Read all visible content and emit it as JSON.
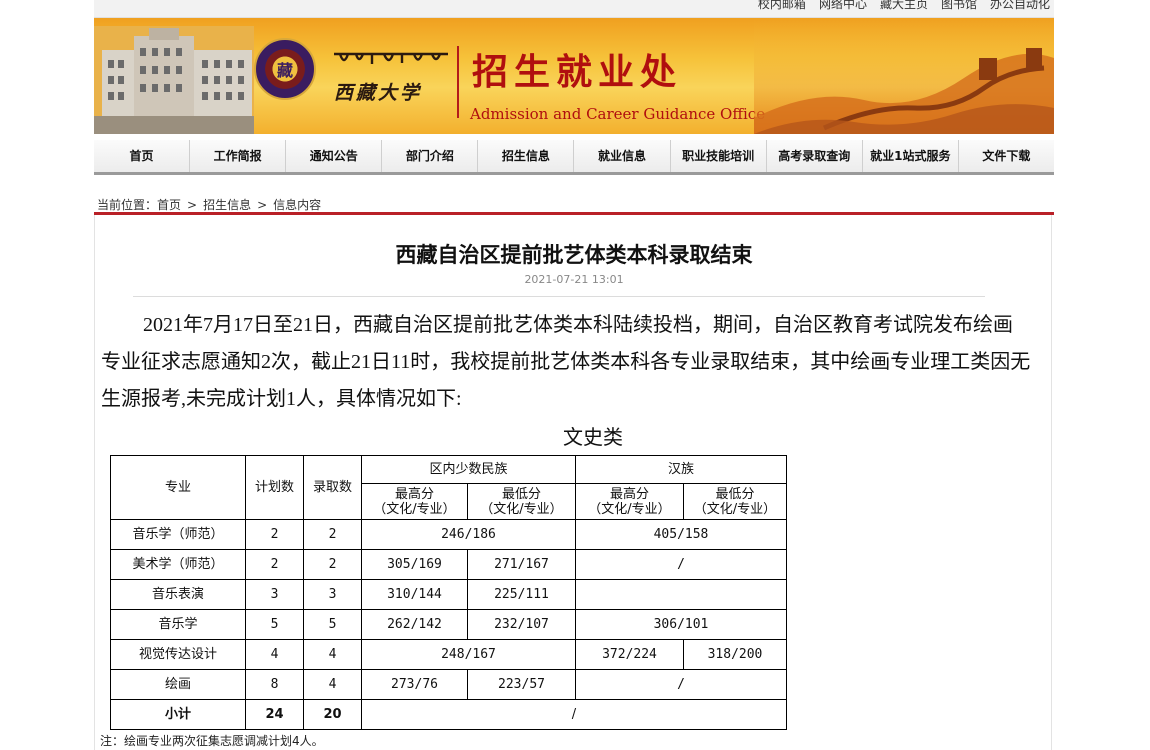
{
  "toplinks": [
    "校内邮箱",
    "网络中心",
    "藏大主页",
    "图书馆",
    "办公自动化"
  ],
  "banner": {
    "seal_char": "藏",
    "university_name": "西藏大学",
    "office_cn": "招生就业处",
    "office_en": "Admission and Career Guidance Office"
  },
  "nav": [
    "首页",
    "工作简报",
    "通知公告",
    "部门介绍",
    "招生信息",
    "就业信息",
    "职业技能培训",
    "高考录取查询",
    "就业1站式服务",
    "文件下载"
  ],
  "breadcrumb": {
    "prefix": "当前位置：",
    "items": [
      "首页",
      "招生信息",
      "信息内容"
    ],
    "separator": ">"
  },
  "article": {
    "title": "西藏自治区提前批艺体类本科录取结束",
    "date": "2021-07-21 13:01",
    "paragraph": "2021年7月17日至21日，西藏自治区提前批艺体类本科陆续投档，期间，自治区教育考试院发布绘画专业征求志愿通知2次，截止21日11时，我校提前批艺体类本科各专业录取结束，其中绘画专业理工类因无生源报考,未完成计划1人，具体情况如下:",
    "table_title": "文史类",
    "table": {
      "h_major": "专业",
      "h_plan": "计划数",
      "h_admit": "录取数",
      "h_minority": "区内少数民族",
      "h_han": "汉族",
      "h_max": "最高分",
      "h_min": "最低分",
      "h_sub": "（文化/专业）",
      "rows": [
        {
          "major": "音乐学（师范）",
          "plan": "2",
          "admit": "2",
          "m_merged": "246/186",
          "h_merged": "405/158"
        },
        {
          "major": "美术学（师范）",
          "plan": "2",
          "admit": "2",
          "m_max": "305/169",
          "m_min": "271/167",
          "h_merged": "/"
        },
        {
          "major": "音乐表演",
          "plan": "3",
          "admit": "3",
          "m_max": "310/144",
          "m_min": "225/111",
          "h_merged": ""
        },
        {
          "major": "音乐学",
          "plan": "5",
          "admit": "5",
          "m_max": "262/142",
          "m_min": "232/107",
          "h_merged": "306/101"
        },
        {
          "major": "视觉传达设计",
          "plan": "4",
          "admit": "4",
          "m_merged": "248/167",
          "h_max": "372/224",
          "h_min": "318/200"
        },
        {
          "major": "绘画",
          "plan": "8",
          "admit": "4",
          "m_max": "273/76",
          "m_min": "223/57",
          "h_merged": "/"
        }
      ],
      "total": {
        "label": "小计",
        "plan": "24",
        "admit": "20",
        "rest": "/"
      }
    },
    "note": "注：绘画专业两次征集志愿调减计划4人。"
  }
}
